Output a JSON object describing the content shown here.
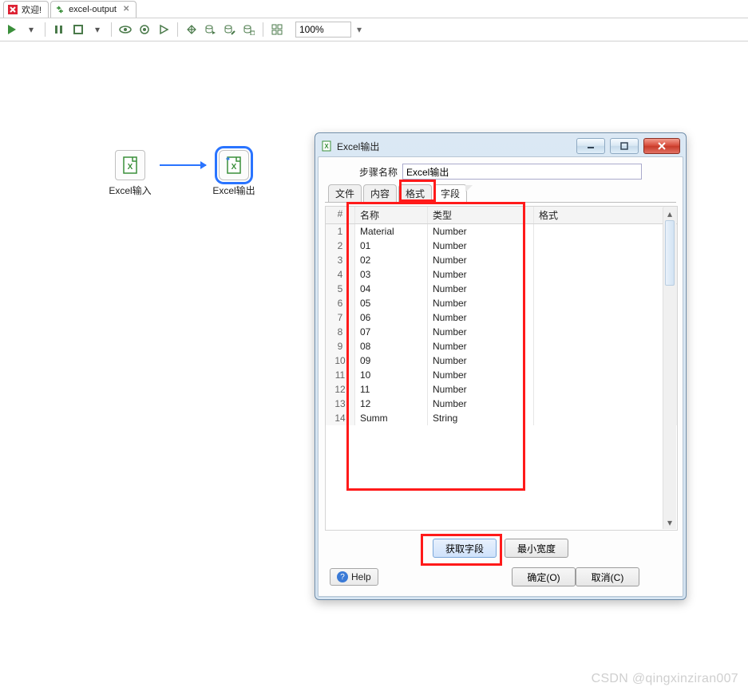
{
  "main_tabs": [
    {
      "label": "欢迎!",
      "icon": "red-x"
    },
    {
      "label": "excel-output",
      "icon": "green-arrows",
      "active": true,
      "closable": true
    }
  ],
  "toolbar": {
    "buttons": [
      "play",
      "sep",
      "pause",
      "stop",
      "sep",
      "eye",
      "gear",
      "play-outline",
      "sep",
      "spark",
      "db-play",
      "db-edit",
      "db-grid",
      "sep",
      "grid-all"
    ],
    "zoom_value": "100%"
  },
  "canvas": {
    "node_a_label": "Excel输入",
    "node_b_label": "Excel输出"
  },
  "dialog": {
    "title": "Excel输出",
    "step_name_label": "步骤名称",
    "step_name_value": "Excel输出",
    "tabs": [
      "文件",
      "内容",
      "格式",
      "字段"
    ],
    "active_tab": "字段",
    "field_columns": {
      "idx": "#",
      "name": "名称",
      "type": "类型",
      "format": "格式"
    },
    "fields": [
      {
        "name": "Material",
        "type": "Number",
        "format": ""
      },
      {
        "name": "01",
        "type": "Number",
        "format": ""
      },
      {
        "name": "02",
        "type": "Number",
        "format": ""
      },
      {
        "name": "03",
        "type": "Number",
        "format": ""
      },
      {
        "name": "04",
        "type": "Number",
        "format": ""
      },
      {
        "name": "05",
        "type": "Number",
        "format": ""
      },
      {
        "name": "06",
        "type": "Number",
        "format": ""
      },
      {
        "name": "07",
        "type": "Number",
        "format": ""
      },
      {
        "name": "08",
        "type": "Number",
        "format": ""
      },
      {
        "name": "09",
        "type": "Number",
        "format": ""
      },
      {
        "name": "10",
        "type": "Number",
        "format": ""
      },
      {
        "name": "11",
        "type": "Number",
        "format": ""
      },
      {
        "name": "12",
        "type": "Number",
        "format": ""
      },
      {
        "name": "Summ",
        "type": "String",
        "format": ""
      }
    ],
    "btn_get_fields": "获取字段",
    "btn_min_width": "最小宽度",
    "btn_ok": "确定(O)",
    "btn_cancel": "取消(C)",
    "help": "Help"
  },
  "watermark": "CSDN @qingxinziran007"
}
